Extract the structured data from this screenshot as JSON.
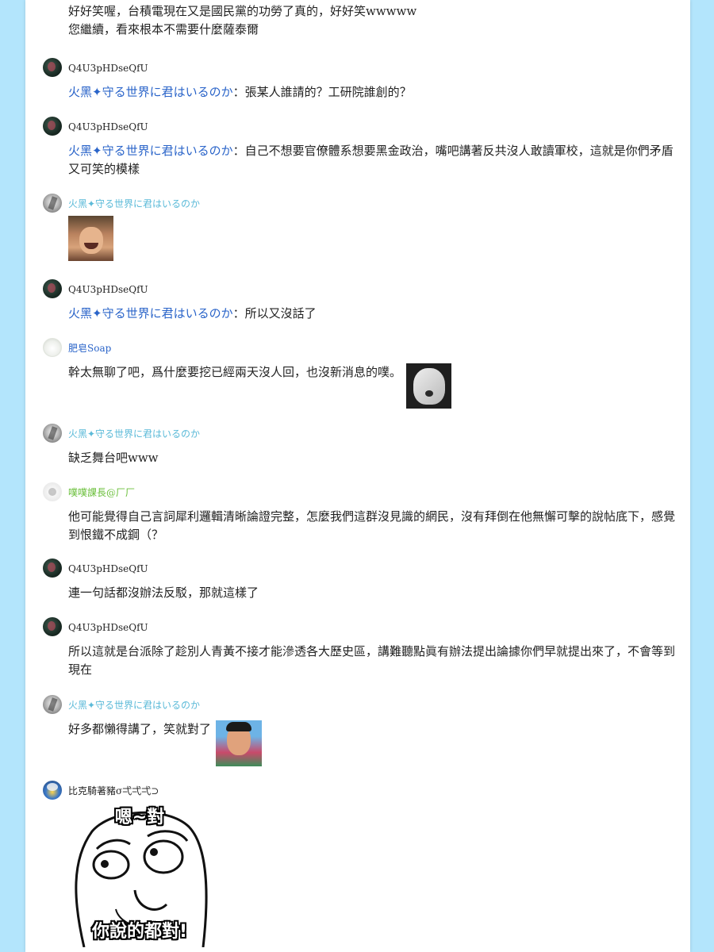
{
  "thread": {
    "top_lines": [
      "好好笑喔，台積電現在又是國民黨的功勞了真的，好好笑wwwww",
      "您繼續，看來根本不需要什麼薩泰爾"
    ],
    "replies": [
      {
        "user": "Q4U3pHDseQfU",
        "mention": "火黑✦守る世界に君はいるのか",
        "text": "：張某人誰請的？工研院誰創的？"
      },
      {
        "user": "Q4U3pHDseQfU",
        "mention": "火黑✦守る世界に君はいるのか",
        "text": "：自己不想要官僚體系想要黑金政治，嘴吧講著反共沒人敢讀軍校，這就是你們矛盾又可笑的模樣"
      },
      {
        "user": "火黑✦守る世界に君はいるのか",
        "text": "",
        "sticker": "laughing-man-sticker"
      },
      {
        "user": "Q4U3pHDseQfU",
        "mention": "火黑✦守る世界に君はいるのか",
        "text": "：所以又沒話了"
      },
      {
        "user": "肥皂Soap",
        "text": "幹太無聊了吧，爲什麼要挖已經兩天沒人回，也沒新消息的噗。",
        "sticker": "robot-face-sticker"
      },
      {
        "user": "火黑✦守る世界に君はいるのか",
        "text": "缺乏舞台吧www"
      },
      {
        "user": "噗噗課長@厂厂",
        "text": "他可能覺得自己言詞犀利邏輯清晰論證完整，怎麼我們這群沒見識的網民，沒有拜倒在他無懈可擊的說帖底下，感覺到恨鐵不成鋼（？"
      },
      {
        "user": "Q4U3pHDseQfU",
        "text": "連一句話都沒辦法反駁，那就這樣了"
      },
      {
        "user": "Q4U3pHDseQfU",
        "text": "所以這就是台派除了趁別人青黃不接才能滲透各大歷史區，講難聽點眞有辦法提出論據你們早就提出來了，不會等到現在"
      },
      {
        "user": "火黑✦守る世界に君はいるのか",
        "text": "好多都懶得講了，笑就對了",
        "sticker": "smiling-boy-sticker"
      },
      {
        "user": "比克騎著豬σ弌弌弌⊃",
        "text": "",
        "meme_top": "嗯~對",
        "meme_bottom": "你說的都對!"
      }
    ]
  },
  "colors": {
    "page_background": "#b3e5fc",
    "panel": "#ffffff",
    "mention_blue": "#2a64c9",
    "name_cyan": "#5bbad8",
    "name_green": "#6abf3a",
    "text": "#222222"
  }
}
